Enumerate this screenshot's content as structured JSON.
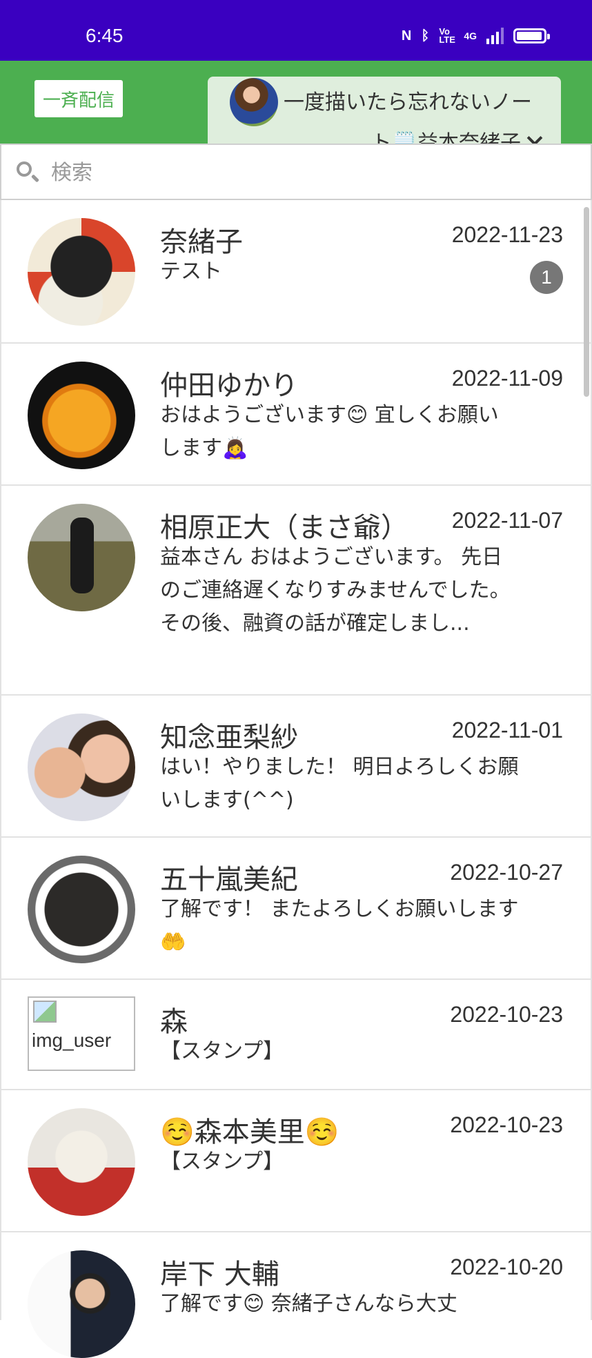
{
  "status_bar": {
    "time": "6:45",
    "icons": [
      "nfc-icon",
      "bluetooth-icon",
      "volte-icon",
      "signal-4g-icon",
      "battery-icon"
    ],
    "volte_label": "Vo LTE",
    "network_label": "4G",
    "battery_level": 0.9
  },
  "header": {
    "broadcast_label": "一斉配信",
    "account_line1": "一度描いたら忘れないノー",
    "account_line2": "ト🗒️益本奈緒子",
    "background_color": "#4caf50"
  },
  "search": {
    "placeholder": "検索",
    "value": ""
  },
  "chats": [
    {
      "name": "奈緒子",
      "date": "2022-11-23",
      "message": "テスト",
      "unread": "1",
      "avatar": "kumamon-avatar"
    },
    {
      "name": "仲田ゆかり",
      "date": "2022-11-09",
      "message": "おはようございます😊 宜しくお願いします🙇‍♀️",
      "avatar": "cat-avatar"
    },
    {
      "name": "相原正大（まさ爺）",
      "date": "2022-11-07",
      "message": "益本さん おはようございます。 先日のご連絡遅くなりすみませんでした。 その後、融資の話が確定しまし...",
      "avatar": "runner-avatar"
    },
    {
      "name": "知念亜梨紗",
      "date": "2022-11-01",
      "message": "はい！やりました！ 明日よろしくお願いします(^^)",
      "avatar": "selfie-avatar"
    },
    {
      "name": "五十嵐美紀",
      "date": "2022-10-27",
      "message": "了解です！ またよろしくお願いします🤲",
      "avatar": "frame-avatar"
    },
    {
      "name": "森",
      "date": "2022-10-23",
      "message": "【スタンプ】",
      "avatar_alt": "img_user"
    },
    {
      "name": "☺️森本美里☺️",
      "date": "2022-10-23",
      "message": "【スタンプ】",
      "avatar": "dog-avatar"
    },
    {
      "name": "岸下 大輔",
      "date": "2022-10-20",
      "message": "了解です😊 奈緒子さんなら大丈",
      "avatar": "man-avatar"
    }
  ]
}
